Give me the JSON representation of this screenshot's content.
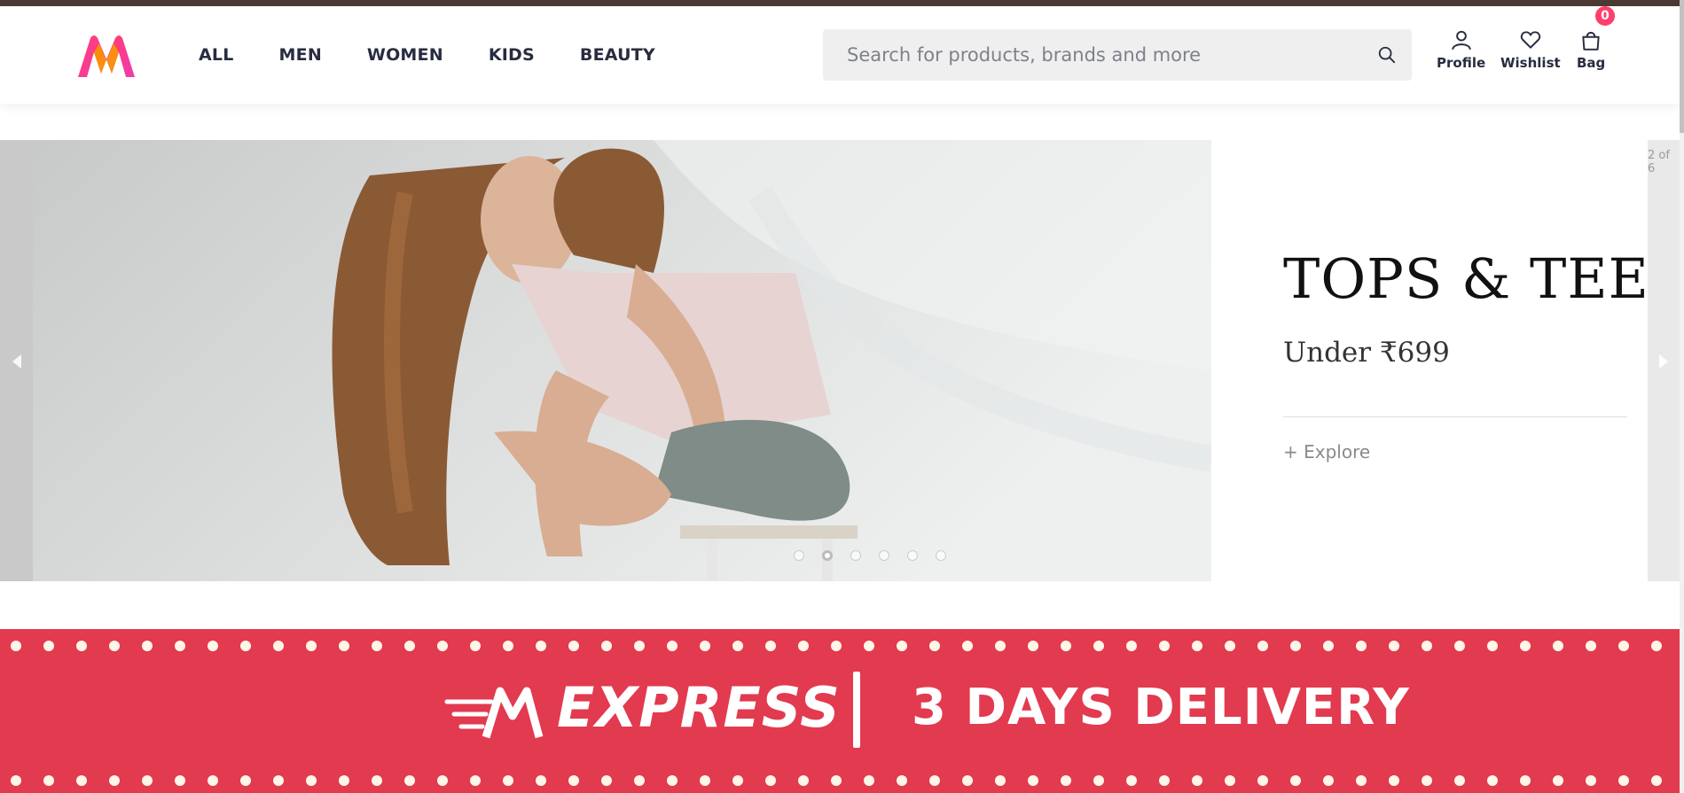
{
  "header": {
    "logo_alt": "Myntra",
    "nav": [
      "ALL",
      "MEN",
      "WOMEN",
      "KIDS",
      "BEAUTY"
    ],
    "search": {
      "placeholder": "Search for products, brands and more",
      "value": ""
    },
    "actions": {
      "profile_label": "Profile",
      "wishlist_label": "Wishlist",
      "bag_label": "Bag",
      "bag_count": "0"
    }
  },
  "hero": {
    "title": "TOPS & TEES",
    "subtitle": "Under ₹699",
    "cta": "+ Explore",
    "slide_counter": "2 of 6",
    "slide_total": 6,
    "active_slide": 2
  },
  "banner": {
    "express": "EXPRESS",
    "delivery": "3 DAYS DELIVERY"
  },
  "colors": {
    "brand_pink": "#ff3f6c",
    "brand_orange": "#f7931e",
    "banner_red": "#e23a4f",
    "top_bar": "#4b3a35"
  }
}
